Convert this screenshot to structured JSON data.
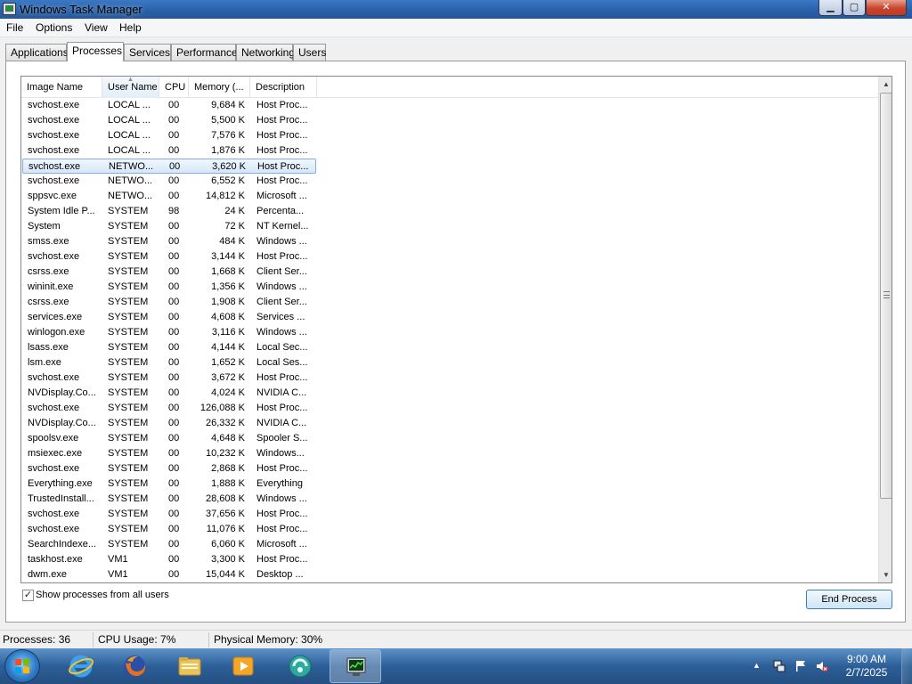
{
  "window": {
    "title": "Windows Task Manager"
  },
  "menu": [
    "File",
    "Options",
    "View",
    "Help"
  ],
  "tabs": [
    "Applications",
    "Processes",
    "Services",
    "Performance",
    "Networking",
    "Users"
  ],
  "active_tab": "Processes",
  "columns": [
    "Image Name",
    "User Name",
    "CPU",
    "Memory (...",
    "Description"
  ],
  "sorted_column": "User Name",
  "processes": [
    [
      "svchost.exe",
      "LOCAL ...",
      "00",
      "9,684 K",
      "Host Proc..."
    ],
    [
      "svchost.exe",
      "LOCAL ...",
      "00",
      "5,500 K",
      "Host Proc..."
    ],
    [
      "svchost.exe",
      "LOCAL ...",
      "00",
      "7,576 K",
      "Host Proc..."
    ],
    [
      "svchost.exe",
      "LOCAL ...",
      "00",
      "1,876 K",
      "Host Proc..."
    ],
    [
      "svchost.exe",
      "NETWO...",
      "00",
      "3,620 K",
      "Host Proc..."
    ],
    [
      "svchost.exe",
      "NETWO...",
      "00",
      "6,552 K",
      "Host Proc..."
    ],
    [
      "sppsvc.exe",
      "NETWO...",
      "00",
      "14,812 K",
      "Microsoft ..."
    ],
    [
      "System Idle P...",
      "SYSTEM",
      "98",
      "24 K",
      "Percenta..."
    ],
    [
      "System",
      "SYSTEM",
      "00",
      "72 K",
      "NT Kernel..."
    ],
    [
      "smss.exe",
      "SYSTEM",
      "00",
      "484 K",
      "Windows ..."
    ],
    [
      "svchost.exe",
      "SYSTEM",
      "00",
      "3,144 K",
      "Host Proc..."
    ],
    [
      "csrss.exe",
      "SYSTEM",
      "00",
      "1,668 K",
      "Client Ser..."
    ],
    [
      "wininit.exe",
      "SYSTEM",
      "00",
      "1,356 K",
      "Windows ..."
    ],
    [
      "csrss.exe",
      "SYSTEM",
      "00",
      "1,908 K",
      "Client Ser..."
    ],
    [
      "services.exe",
      "SYSTEM",
      "00",
      "4,608 K",
      "Services ..."
    ],
    [
      "winlogon.exe",
      "SYSTEM",
      "00",
      "3,116 K",
      "Windows ..."
    ],
    [
      "lsass.exe",
      "SYSTEM",
      "00",
      "4,144 K",
      "Local Sec..."
    ],
    [
      "lsm.exe",
      "SYSTEM",
      "00",
      "1,652 K",
      "Local Ses..."
    ],
    [
      "svchost.exe",
      "SYSTEM",
      "00",
      "3,672 K",
      "Host Proc..."
    ],
    [
      "NVDisplay.Co...",
      "SYSTEM",
      "00",
      "4,024 K",
      "NVIDIA C..."
    ],
    [
      "svchost.exe",
      "SYSTEM",
      "00",
      "126,088 K",
      "Host Proc..."
    ],
    [
      "NVDisplay.Co...",
      "SYSTEM",
      "00",
      "26,332 K",
      "NVIDIA C..."
    ],
    [
      "spoolsv.exe",
      "SYSTEM",
      "00",
      "4,648 K",
      "Spooler S..."
    ],
    [
      "msiexec.exe",
      "SYSTEM",
      "00",
      "10,232 K",
      "Windows..."
    ],
    [
      "svchost.exe",
      "SYSTEM",
      "00",
      "2,868 K",
      "Host Proc..."
    ],
    [
      "Everything.exe",
      "SYSTEM",
      "00",
      "1,888 K",
      "Everything"
    ],
    [
      "TrustedInstall...",
      "SYSTEM",
      "00",
      "28,608 K",
      "Windows ..."
    ],
    [
      "svchost.exe",
      "SYSTEM",
      "00",
      "37,656 K",
      "Host Proc..."
    ],
    [
      "svchost.exe",
      "SYSTEM",
      "00",
      "11,076 K",
      "Host Proc..."
    ],
    [
      "SearchIndexe...",
      "SYSTEM",
      "00",
      "6,060 K",
      "Microsoft ..."
    ],
    [
      "taskhost.exe",
      "VM1",
      "00",
      "3,300 K",
      "Host Proc..."
    ],
    [
      "dwm.exe",
      "VM1",
      "00",
      "15,044 K",
      "Desktop ..."
    ]
  ],
  "selected_row": 4,
  "show_all_users": {
    "label": "Show processes from all users",
    "checked": true
  },
  "end_process_label": "End Process",
  "status": {
    "processes": "Processes: 36",
    "cpu": "CPU Usage: 7%",
    "memory": "Physical Memory: 30%"
  },
  "taskbar": {
    "apps": [
      "start-orb",
      "internet-explorer-icon",
      "firefox-icon",
      "file-explorer-icon",
      "media-player-icon",
      "network-app-icon",
      "task-manager-icon"
    ],
    "time": "9:00 AM",
    "date": "2/7/2025"
  }
}
